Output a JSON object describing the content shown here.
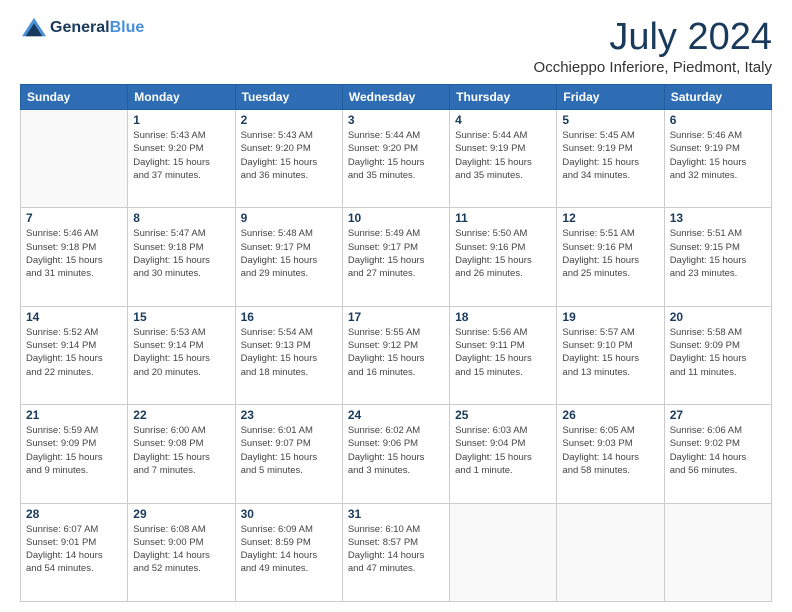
{
  "header": {
    "logo_line1": "General",
    "logo_line2": "Blue",
    "month": "July 2024",
    "location": "Occhieppo Inferiore, Piedmont, Italy"
  },
  "weekdays": [
    "Sunday",
    "Monday",
    "Tuesday",
    "Wednesday",
    "Thursday",
    "Friday",
    "Saturday"
  ],
  "weeks": [
    [
      {
        "day": "",
        "info": ""
      },
      {
        "day": "1",
        "info": "Sunrise: 5:43 AM\nSunset: 9:20 PM\nDaylight: 15 hours\nand 37 minutes."
      },
      {
        "day": "2",
        "info": "Sunrise: 5:43 AM\nSunset: 9:20 PM\nDaylight: 15 hours\nand 36 minutes."
      },
      {
        "day": "3",
        "info": "Sunrise: 5:44 AM\nSunset: 9:20 PM\nDaylight: 15 hours\nand 35 minutes."
      },
      {
        "day": "4",
        "info": "Sunrise: 5:44 AM\nSunset: 9:19 PM\nDaylight: 15 hours\nand 35 minutes."
      },
      {
        "day": "5",
        "info": "Sunrise: 5:45 AM\nSunset: 9:19 PM\nDaylight: 15 hours\nand 34 minutes."
      },
      {
        "day": "6",
        "info": "Sunrise: 5:46 AM\nSunset: 9:19 PM\nDaylight: 15 hours\nand 32 minutes."
      }
    ],
    [
      {
        "day": "7",
        "info": "Sunrise: 5:46 AM\nSunset: 9:18 PM\nDaylight: 15 hours\nand 31 minutes."
      },
      {
        "day": "8",
        "info": "Sunrise: 5:47 AM\nSunset: 9:18 PM\nDaylight: 15 hours\nand 30 minutes."
      },
      {
        "day": "9",
        "info": "Sunrise: 5:48 AM\nSunset: 9:17 PM\nDaylight: 15 hours\nand 29 minutes."
      },
      {
        "day": "10",
        "info": "Sunrise: 5:49 AM\nSunset: 9:17 PM\nDaylight: 15 hours\nand 27 minutes."
      },
      {
        "day": "11",
        "info": "Sunrise: 5:50 AM\nSunset: 9:16 PM\nDaylight: 15 hours\nand 26 minutes."
      },
      {
        "day": "12",
        "info": "Sunrise: 5:51 AM\nSunset: 9:16 PM\nDaylight: 15 hours\nand 25 minutes."
      },
      {
        "day": "13",
        "info": "Sunrise: 5:51 AM\nSunset: 9:15 PM\nDaylight: 15 hours\nand 23 minutes."
      }
    ],
    [
      {
        "day": "14",
        "info": "Sunrise: 5:52 AM\nSunset: 9:14 PM\nDaylight: 15 hours\nand 22 minutes."
      },
      {
        "day": "15",
        "info": "Sunrise: 5:53 AM\nSunset: 9:14 PM\nDaylight: 15 hours\nand 20 minutes."
      },
      {
        "day": "16",
        "info": "Sunrise: 5:54 AM\nSunset: 9:13 PM\nDaylight: 15 hours\nand 18 minutes."
      },
      {
        "day": "17",
        "info": "Sunrise: 5:55 AM\nSunset: 9:12 PM\nDaylight: 15 hours\nand 16 minutes."
      },
      {
        "day": "18",
        "info": "Sunrise: 5:56 AM\nSunset: 9:11 PM\nDaylight: 15 hours\nand 15 minutes."
      },
      {
        "day": "19",
        "info": "Sunrise: 5:57 AM\nSunset: 9:10 PM\nDaylight: 15 hours\nand 13 minutes."
      },
      {
        "day": "20",
        "info": "Sunrise: 5:58 AM\nSunset: 9:09 PM\nDaylight: 15 hours\nand 11 minutes."
      }
    ],
    [
      {
        "day": "21",
        "info": "Sunrise: 5:59 AM\nSunset: 9:09 PM\nDaylight: 15 hours\nand 9 minutes."
      },
      {
        "day": "22",
        "info": "Sunrise: 6:00 AM\nSunset: 9:08 PM\nDaylight: 15 hours\nand 7 minutes."
      },
      {
        "day": "23",
        "info": "Sunrise: 6:01 AM\nSunset: 9:07 PM\nDaylight: 15 hours\nand 5 minutes."
      },
      {
        "day": "24",
        "info": "Sunrise: 6:02 AM\nSunset: 9:06 PM\nDaylight: 15 hours\nand 3 minutes."
      },
      {
        "day": "25",
        "info": "Sunrise: 6:03 AM\nSunset: 9:04 PM\nDaylight: 15 hours\nand 1 minute."
      },
      {
        "day": "26",
        "info": "Sunrise: 6:05 AM\nSunset: 9:03 PM\nDaylight: 14 hours\nand 58 minutes."
      },
      {
        "day": "27",
        "info": "Sunrise: 6:06 AM\nSunset: 9:02 PM\nDaylight: 14 hours\nand 56 minutes."
      }
    ],
    [
      {
        "day": "28",
        "info": "Sunrise: 6:07 AM\nSunset: 9:01 PM\nDaylight: 14 hours\nand 54 minutes."
      },
      {
        "day": "29",
        "info": "Sunrise: 6:08 AM\nSunset: 9:00 PM\nDaylight: 14 hours\nand 52 minutes."
      },
      {
        "day": "30",
        "info": "Sunrise: 6:09 AM\nSunset: 8:59 PM\nDaylight: 14 hours\nand 49 minutes."
      },
      {
        "day": "31",
        "info": "Sunrise: 6:10 AM\nSunset: 8:57 PM\nDaylight: 14 hours\nand 47 minutes."
      },
      {
        "day": "",
        "info": ""
      },
      {
        "day": "",
        "info": ""
      },
      {
        "day": "",
        "info": ""
      }
    ]
  ]
}
